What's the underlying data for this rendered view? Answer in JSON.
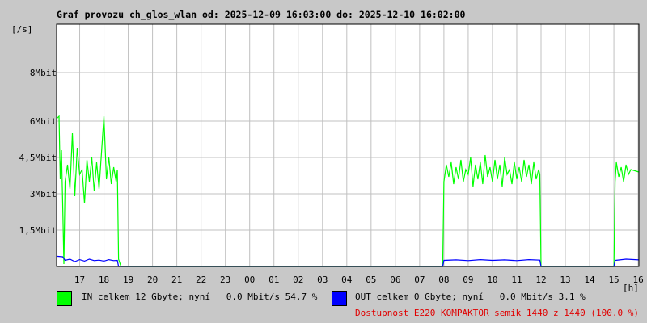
{
  "chart_data": {
    "type": "line",
    "title": "Graf provozu ch_glos_wlan od: 2025-12-09 16:03:00 do: 2025-12-10 16:02:00",
    "ylabel": "[/s]",
    "xlabel": "[h]",
    "y_unit_label": "Mbit",
    "ylim": [
      0,
      10
    ],
    "yticks": [
      {
        "value": 1.5,
        "label": "1,5Mbit"
      },
      {
        "value": 3,
        "label": "3Mbit"
      },
      {
        "value": 4.5,
        "label": "4,5Mbit"
      },
      {
        "value": 6,
        "label": "6Mbit"
      },
      {
        "value": 8,
        "label": "8Mbit"
      }
    ],
    "x_range_hours": [
      16.05,
      40.03
    ],
    "xticks": [
      {
        "value": 17,
        "label": "17"
      },
      {
        "value": 18,
        "label": "18"
      },
      {
        "value": 19,
        "label": "19"
      },
      {
        "value": 20,
        "label": "20"
      },
      {
        "value": 21,
        "label": "21"
      },
      {
        "value": 22,
        "label": "22"
      },
      {
        "value": 23,
        "label": "23"
      },
      {
        "value": 24,
        "label": "00"
      },
      {
        "value": 25,
        "label": "01"
      },
      {
        "value": 26,
        "label": "02"
      },
      {
        "value": 27,
        "label": "03"
      },
      {
        "value": 28,
        "label": "04"
      },
      {
        "value": 29,
        "label": "05"
      },
      {
        "value": 30,
        "label": "06"
      },
      {
        "value": 31,
        "label": "07"
      },
      {
        "value": 32,
        "label": "08"
      },
      {
        "value": 33,
        "label": "09"
      },
      {
        "value": 34,
        "label": "10"
      },
      {
        "value": 35,
        "label": "11"
      },
      {
        "value": 36,
        "label": "12"
      },
      {
        "value": 37,
        "label": "13"
      },
      {
        "value": 38,
        "label": "14"
      },
      {
        "value": 39,
        "label": "15"
      },
      {
        "value": 40,
        "label": "16"
      }
    ],
    "grid": true,
    "series": [
      {
        "name": "IN",
        "color": "#00ff00",
        "points": [
          [
            16.05,
            6.1
          ],
          [
            16.15,
            6.2
          ],
          [
            16.2,
            3.6
          ],
          [
            16.25,
            4.8
          ],
          [
            16.3,
            2.6
          ],
          [
            16.35,
            0.1
          ],
          [
            16.4,
            3.5
          ],
          [
            16.5,
            4.2
          ],
          [
            16.6,
            3.2
          ],
          [
            16.7,
            5.5
          ],
          [
            16.8,
            2.9
          ],
          [
            16.9,
            4.9
          ],
          [
            17.0,
            3.8
          ],
          [
            17.1,
            4.0
          ],
          [
            17.2,
            2.6
          ],
          [
            17.3,
            4.4
          ],
          [
            17.4,
            3.5
          ],
          [
            17.5,
            4.5
          ],
          [
            17.6,
            3.1
          ],
          [
            17.7,
            4.3
          ],
          [
            17.8,
            3.2
          ],
          [
            17.9,
            4.7
          ],
          [
            18.0,
            6.2
          ],
          [
            18.1,
            3.6
          ],
          [
            18.2,
            4.5
          ],
          [
            18.3,
            3.4
          ],
          [
            18.4,
            4.1
          ],
          [
            18.5,
            3.5
          ],
          [
            18.55,
            4.0
          ],
          [
            18.6,
            0.3
          ],
          [
            18.7,
            0.0
          ],
          [
            31.95,
            0.0
          ],
          [
            32.0,
            3.5
          ],
          [
            32.1,
            4.2
          ],
          [
            32.2,
            3.7
          ],
          [
            32.3,
            4.3
          ],
          [
            32.4,
            3.4
          ],
          [
            32.5,
            4.1
          ],
          [
            32.6,
            3.6
          ],
          [
            32.7,
            4.4
          ],
          [
            32.8,
            3.5
          ],
          [
            32.9,
            4.0
          ],
          [
            33.0,
            3.8
          ],
          [
            33.1,
            4.5
          ],
          [
            33.2,
            3.3
          ],
          [
            33.3,
            4.2
          ],
          [
            33.4,
            3.6
          ],
          [
            33.5,
            4.3
          ],
          [
            33.6,
            3.4
          ],
          [
            33.7,
            4.6
          ],
          [
            33.8,
            3.7
          ],
          [
            33.9,
            4.1
          ],
          [
            34.0,
            3.5
          ],
          [
            34.1,
            4.4
          ],
          [
            34.2,
            3.6
          ],
          [
            34.3,
            4.2
          ],
          [
            34.4,
            3.3
          ],
          [
            34.5,
            4.5
          ],
          [
            34.6,
            3.8
          ],
          [
            34.7,
            4.0
          ],
          [
            34.8,
            3.4
          ],
          [
            34.9,
            4.3
          ],
          [
            35.0,
            3.6
          ],
          [
            35.1,
            4.1
          ],
          [
            35.2,
            3.5
          ],
          [
            35.3,
            4.4
          ],
          [
            35.4,
            3.7
          ],
          [
            35.5,
            4.2
          ],
          [
            35.6,
            3.4
          ],
          [
            35.7,
            4.3
          ],
          [
            35.8,
            3.6
          ],
          [
            35.9,
            4.0
          ],
          [
            35.95,
            3.8
          ],
          [
            36.0,
            0.0
          ],
          [
            39.0,
            0.0
          ],
          [
            39.05,
            3.5
          ],
          [
            39.1,
            4.3
          ],
          [
            39.2,
            3.7
          ],
          [
            39.3,
            4.1
          ],
          [
            39.4,
            3.5
          ],
          [
            39.5,
            4.2
          ],
          [
            39.6,
            3.8
          ],
          [
            39.7,
            4.0
          ],
          [
            40.03,
            3.9
          ]
        ]
      },
      {
        "name": "OUT",
        "color": "#0000ff",
        "points": [
          [
            16.05,
            0.42
          ],
          [
            16.3,
            0.4
          ],
          [
            16.4,
            0.25
          ],
          [
            16.6,
            0.3
          ],
          [
            16.8,
            0.2
          ],
          [
            17.0,
            0.28
          ],
          [
            17.2,
            0.22
          ],
          [
            17.4,
            0.3
          ],
          [
            17.6,
            0.24
          ],
          [
            17.8,
            0.26
          ],
          [
            18.0,
            0.22
          ],
          [
            18.2,
            0.28
          ],
          [
            18.4,
            0.24
          ],
          [
            18.55,
            0.25
          ],
          [
            18.6,
            0.0
          ],
          [
            31.95,
            0.0
          ],
          [
            32.0,
            0.25
          ],
          [
            32.5,
            0.27
          ],
          [
            33.0,
            0.24
          ],
          [
            33.5,
            0.28
          ],
          [
            34.0,
            0.25
          ],
          [
            34.5,
            0.27
          ],
          [
            35.0,
            0.24
          ],
          [
            35.5,
            0.28
          ],
          [
            35.95,
            0.26
          ],
          [
            36.0,
            0.0
          ],
          [
            39.0,
            0.0
          ],
          [
            39.05,
            0.25
          ],
          [
            39.5,
            0.3
          ],
          [
            40.03,
            0.27
          ]
        ]
      }
    ]
  },
  "legend": {
    "in_color": "#00ff00",
    "out_color": "#0000ff",
    "in_text": "IN celkem 12 Gbyte; nyní   0.0 Mbit/s 54.7 %",
    "out_text": "OUT celkem 0 Gbyte; nyní   0.0 Mbit/s 3.1 %",
    "availability_text": "Dostupnost E220 KOMPAKTOR semik 1440 z 1440 (100.0 %)",
    "availability_color": "#e00000"
  }
}
